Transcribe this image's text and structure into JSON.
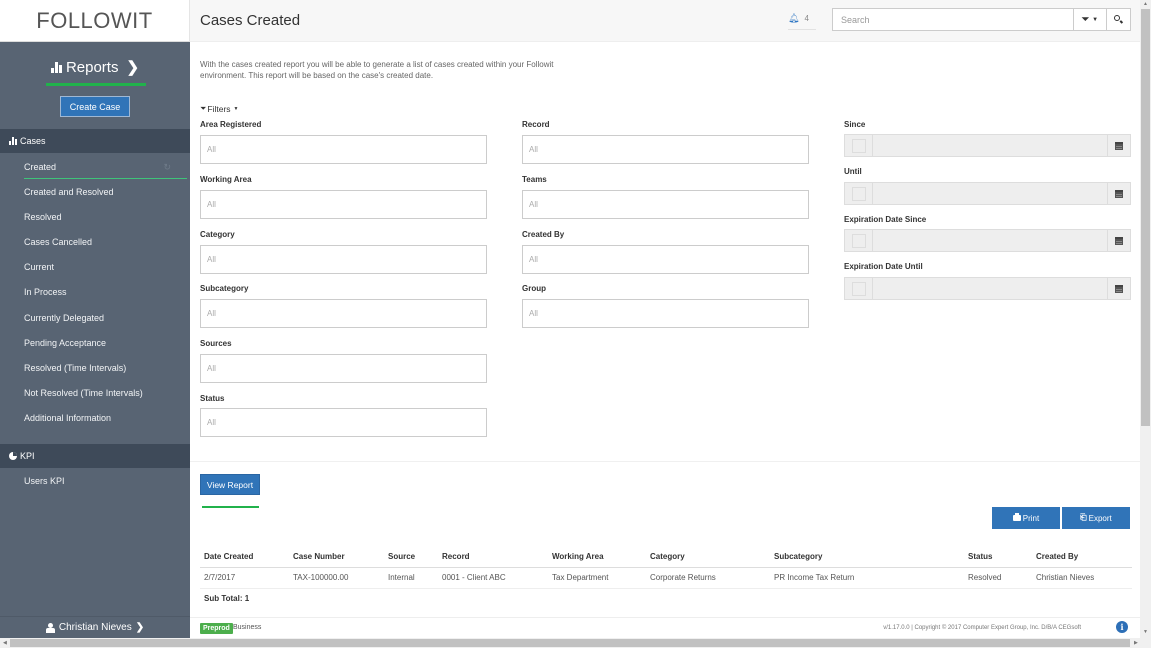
{
  "app": {
    "logo_text": "FOLLOWIT"
  },
  "sidebar": {
    "reports_label": "Reports",
    "create_case_label": "Create Case",
    "sections": [
      {
        "title": "Cases",
        "icon": "bar-chart-icon",
        "items": [
          {
            "label": "Created",
            "active": true
          },
          {
            "label": "Created and Resolved"
          },
          {
            "label": "Resolved"
          },
          {
            "label": "Cases Cancelled"
          },
          {
            "label": "Current"
          },
          {
            "label": "In Process"
          },
          {
            "label": "Currently Delegated"
          },
          {
            "label": "Pending Acceptance"
          },
          {
            "label": "Resolved (Time Intervals)"
          },
          {
            "label": "Not Resolved (Time Intervals)"
          },
          {
            "label": "Additional Information"
          }
        ]
      },
      {
        "title": "KPI",
        "icon": "pie-chart-icon",
        "items": [
          {
            "label": "Users KPI"
          }
        ]
      }
    ],
    "user_name": "Christian Nieves"
  },
  "header": {
    "title": "Cases Created",
    "notification_count": "4",
    "search_placeholder": "Search"
  },
  "main": {
    "description": "With the cases created report you will be able to generate a list of cases created within your Followit environment. This report will be based on the case's created date.",
    "filters_label": "Filters",
    "filters_col1": [
      {
        "label": "Area Registered",
        "value": "All"
      },
      {
        "label": "Working Area",
        "value": "All"
      },
      {
        "label": "Category",
        "value": "All"
      },
      {
        "label": "Subcategory",
        "value": "All"
      },
      {
        "label": "Sources",
        "value": "All"
      },
      {
        "label": "Status",
        "value": "All"
      }
    ],
    "filters_col2": [
      {
        "label": "Record",
        "value": "All"
      },
      {
        "label": "Teams",
        "value": "All"
      },
      {
        "label": "Created By",
        "value": "All"
      },
      {
        "label": "Group",
        "value": "All"
      }
    ],
    "date_filters": [
      {
        "label": "Since",
        "value": ""
      },
      {
        "label": "Until",
        "value": ""
      },
      {
        "label": "Expiration Date Since",
        "value": ""
      },
      {
        "label": "Expiration Date Until",
        "value": ""
      }
    ],
    "view_report_label": "View Report",
    "print_label": "Print",
    "export_label": "Export",
    "table": {
      "columns": [
        "Date Created",
        "Case Number",
        "Source",
        "Record",
        "Working Area",
        "Category",
        "Subcategory",
        "Status",
        "Created By"
      ],
      "rows": [
        [
          "2/7/2017",
          "TAX-100000.00",
          "Internal",
          "0001 - Client ABC",
          "Tax Department",
          "Corporate Returns",
          "PR Income Tax Return",
          "Resolved",
          "Christian Nieves"
        ]
      ],
      "subtotal": "Sub Total: 1"
    }
  },
  "footer": {
    "env_badge": "Preprod",
    "env_name": "Business",
    "copyright": "v/1.17.0.0 | Copyright © 2017 Computer Expert Group, Inc. D/B/A CEGsoft"
  },
  "colors": {
    "sidebar_bg": "#586473",
    "sidebar_section_bg": "#3e4a59",
    "primary": "#3074b8",
    "accent_green": "#21b24b",
    "badge_green": "#4cae4c"
  }
}
